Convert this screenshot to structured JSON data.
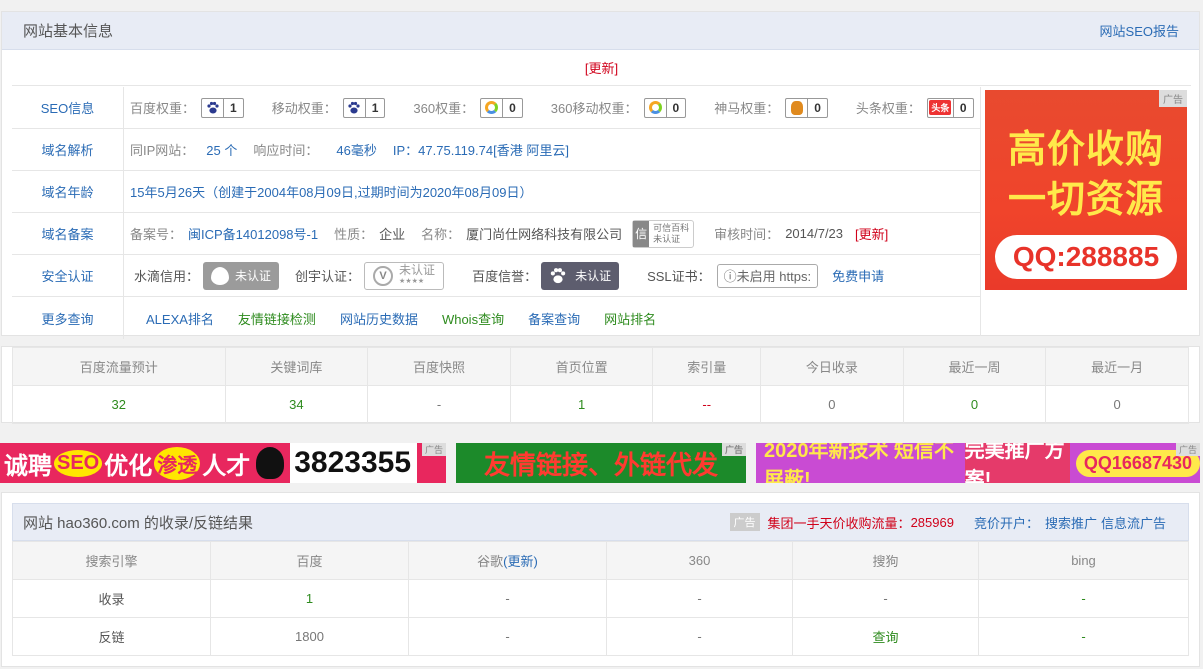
{
  "basic": {
    "title": "网站基本信息",
    "seo_report": "网站SEO报告",
    "update": "[更新]",
    "seo": {
      "label": "SEO信息",
      "items": [
        {
          "name": "百度权重：",
          "value": "1"
        },
        {
          "name": "移动权重：",
          "value": "1"
        },
        {
          "name": "360权重：",
          "value": "0"
        },
        {
          "name": "360移动权重：",
          "value": "0"
        },
        {
          "name": "神马权重：",
          "value": "0"
        },
        {
          "name": "头条权重：",
          "value": "0"
        }
      ],
      "toutiao_icon": "头条"
    },
    "dns": {
      "label": "域名解析",
      "same_ip_k": "同IP网站：",
      "same_ip_v": "25 个",
      "resp_k": "响应时间：",
      "resp_v": "46毫秒",
      "ip_k": "IP：",
      "ip_v": "47.75.119.74[香港 阿里云]"
    },
    "age": {
      "label": "域名年龄",
      "value": "15年5月26天（创建于2004年08月09日,过期时间为2020年08月09日）"
    },
    "icp": {
      "label": "域名备案",
      "no_k": "备案号：",
      "no_v": "闽ICP备14012098号-1",
      "type_k": "性质：",
      "type_v": "企业",
      "name_k": "名称：",
      "name_v": "厦门尚仕网络科技有限公司",
      "trust_icon": "信",
      "trust_l1": "可信百科",
      "trust_l2": "未认证",
      "date_k": "审核时间：",
      "date_v": "2014/7/23",
      "update": "[更新]"
    },
    "cert": {
      "label": "安全认证",
      "shuidi_k": "水滴信用：",
      "shuidi_v": "未认证",
      "chuangyu_k": "创宇认证：",
      "chuangyu_v": "未认证",
      "chuangyu_stars": "★★★★",
      "baidu_k": "百度信誉：",
      "baidu_v": "未认证",
      "ssl_k": "SSL证书：",
      "ssl_v": "ⓘ未启用 https:",
      "apply": "免费申请"
    },
    "more": {
      "label": "更多查询",
      "links": [
        "ALEXA排名",
        "友情链接检测",
        "网站历史数据",
        "Whois查询",
        "备案查询",
        "网站排名"
      ]
    }
  },
  "ad_right": {
    "tag": "广告",
    "line1": "高价收购",
    "line2": "一切资源",
    "qq": "QQ:288885"
  },
  "stats": {
    "headers": [
      "百度流量预计",
      "关键词库",
      "百度快照",
      "首页位置",
      "索引量",
      "今日收录",
      "最近一周",
      "最近一月"
    ],
    "values": [
      "32",
      "34",
      "-",
      "1",
      "--",
      "0",
      "0",
      "0"
    ]
  },
  "ads": {
    "a1": {
      "w1": "诚聘",
      "w2": "SEO",
      "w3": "优化",
      "w4": "渗透",
      "w5": "人才",
      "num": "3823355",
      "tag": "广告"
    },
    "a2": {
      "text": "友情链接、外链代发",
      "tag": "广告"
    },
    "a3": {
      "g": "2020年新技术 短信不屏蔽!",
      "p": "完美推广方案!",
      "qq": "QQ16687430",
      "tag": "广告"
    }
  },
  "backlink": {
    "title": "网站 hao360.com 的收录/反链结果",
    "tag": "广告",
    "promo": "集团一手天价收购流量：",
    "promo_num": "285969",
    "bid_k": "竞价开户：",
    "bid_links": [
      "搜索推广",
      "信息流广告"
    ],
    "headers": [
      "搜索引擎",
      "百度",
      "谷歌",
      "360",
      "搜狗",
      "bing"
    ],
    "google_update": "(更新)",
    "rows": [
      {
        "name": "收录",
        "cells": [
          "1",
          "-",
          "-",
          "-",
          "-"
        ]
      },
      {
        "name": "反链",
        "cells": [
          "1800",
          "-",
          "-",
          "查询",
          "-"
        ]
      }
    ]
  }
}
